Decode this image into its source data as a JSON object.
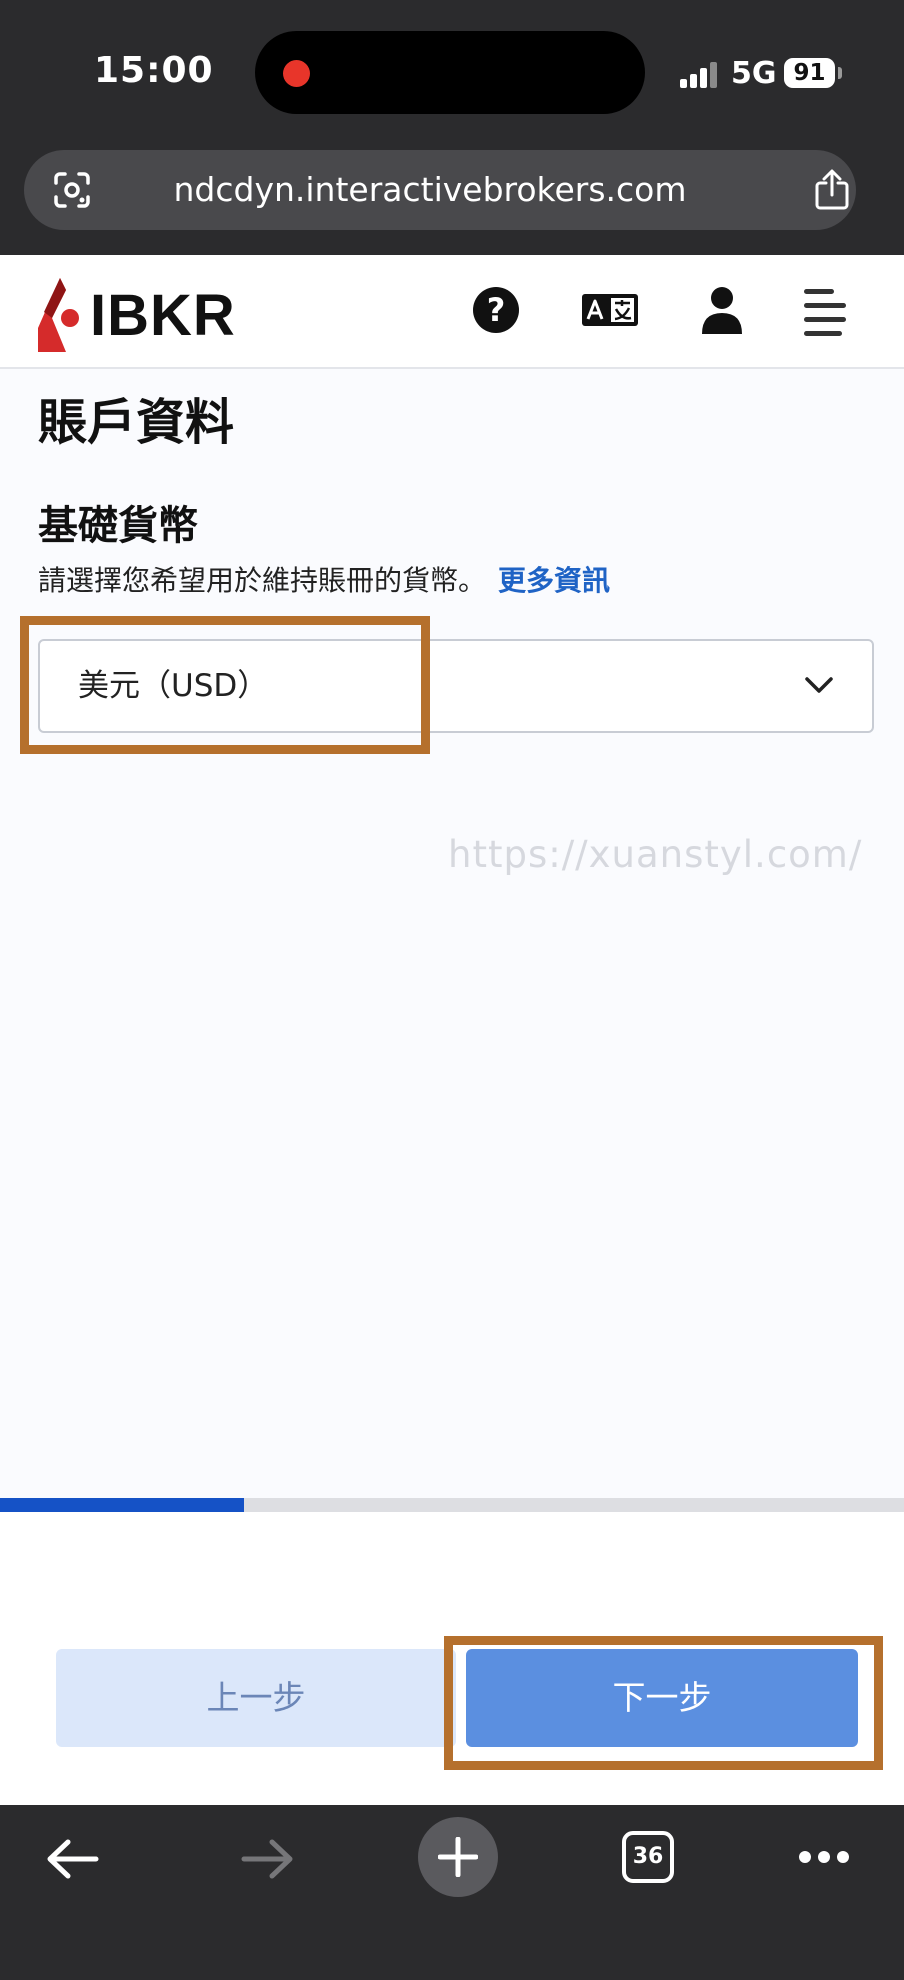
{
  "status_bar": {
    "time": "15:00",
    "network": "5G",
    "battery": "91"
  },
  "browser": {
    "url": "ndcdyn.interactivebrokers.com",
    "tabs_count": "36",
    "icons": [
      "google-lens-icon",
      "share-icon",
      "back-arrow-icon",
      "forward-arrow-icon",
      "plus-icon",
      "tabs-icon",
      "more-icon"
    ]
  },
  "header": {
    "logo_text": "IBKR",
    "help_glyph": "?",
    "icons": [
      "help-icon",
      "language-icon",
      "user-icon",
      "menu-icon"
    ]
  },
  "main": {
    "page_title": "賬戶資料",
    "section_title": "基礎貨幣",
    "section_desc": "請選擇您希望用於維持賬冊的貨幣。",
    "more_link": "更多資訊",
    "currency_select": {
      "value": "美元（USD）"
    },
    "watermark": "https://xuanstyl.com/",
    "progress": 0.27
  },
  "footer": {
    "prev_label": "上一步",
    "next_label": "下一步"
  },
  "colors": {
    "brand_red": "#d52b2b",
    "link_blue": "#1f63c5",
    "progress_blue": "#1552c6",
    "next_button": "#5b8fe0",
    "prev_button": "#dbe7fa",
    "highlight": "#b5702d"
  }
}
